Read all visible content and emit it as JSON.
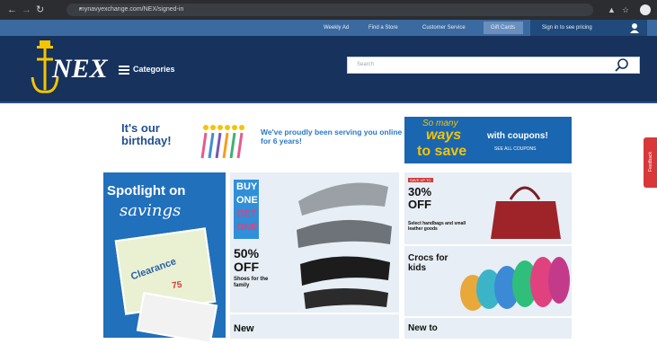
{
  "browser": {
    "url": "mynavyexchange.com/NEX/signed-in"
  },
  "topbar": {
    "links": [
      "Weekly Ad",
      "Find a Store",
      "Customer Service",
      "Gift Cards"
    ],
    "signin": "Sign in to see pricing"
  },
  "header": {
    "logo": "NEX",
    "categories": "Categories",
    "search_placeholder": "Search"
  },
  "promo": {
    "birthday_title": "It's our birthday!",
    "birthday_msg": "We've proudly been serving you online for 6 years!",
    "coupon_script": "So many",
    "coupon_ways": "ways",
    "coupon_save": "to save",
    "coupon_with": "with coupons!",
    "coupon_see": "SEE ALL COUPONS"
  },
  "tiles": {
    "spotlight_1": "Spotlight on",
    "spotlight_2": "savings",
    "spotlight_clearance": "Clearance",
    "spotlight_pct": "75",
    "bogo_1": "BUY",
    "bogo_2": "ONE",
    "bogo_3": "GET",
    "bogo_4": "ONE",
    "shoes_pct": "50%",
    "shoes_off": "OFF",
    "shoes_sub": "Shoes for the family",
    "new_label": "New",
    "bags_tag": "SAVE UP TO",
    "bags_pct": "30%",
    "bags_off": "OFF",
    "bags_sub": "Select handbags and small leather goods",
    "crocs_title": "Crocs for kids",
    "newto_label": "New to",
    "feedback": "Feedback"
  },
  "colors": {
    "header": "#16325d",
    "topbar": "#3b6aa0",
    "accent_blue": "#2070bc",
    "bogo_pink": "#e0427f",
    "feedback_red": "#d9383a"
  }
}
